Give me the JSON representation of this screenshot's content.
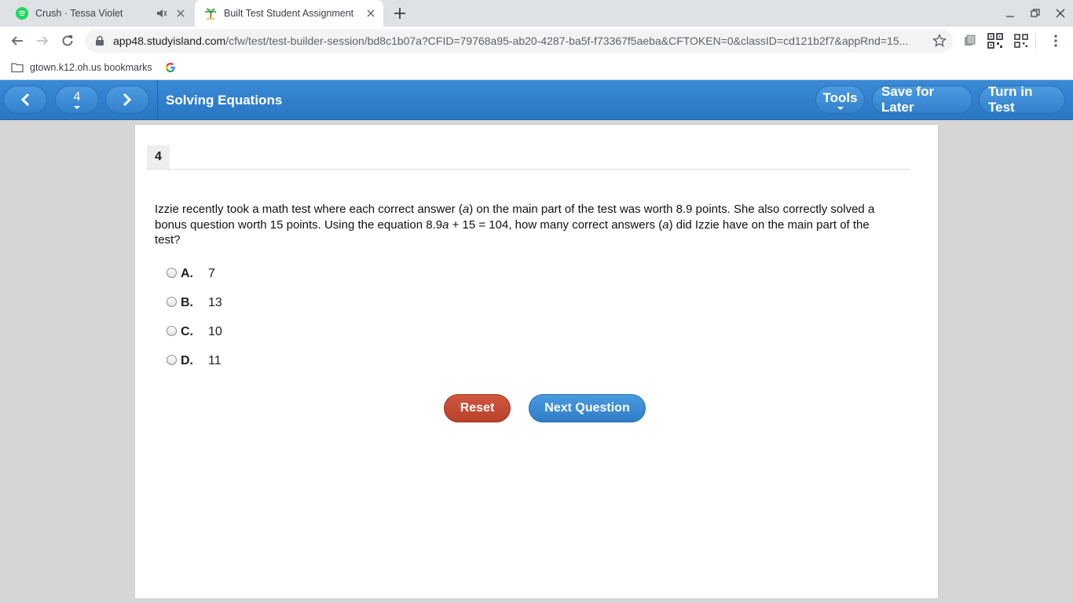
{
  "browser": {
    "tabs": [
      {
        "title": "Crush · Tessa Violet",
        "icon": "spotify-icon",
        "active": false
      },
      {
        "title": "Built Test Student Assignment",
        "icon": "studyisland-palm-icon",
        "active": true
      }
    ],
    "url_host": "app48.studyisland.com",
    "url_path": "/cfw/test/test-builder-session/bd8c1b07a?CFID=79768a95-ab20-4287-ba5f-f73367f5aeba&CFTOKEN=0&classID=cd121b2f7&appRnd=15...",
    "bookmarks": [
      {
        "label": "gtown.k12.oh.us bookmarks",
        "icon": "folder-icon"
      },
      {
        "label": "",
        "icon": "google-icon"
      }
    ]
  },
  "header": {
    "question_number": "4",
    "title": "Solving Equations",
    "tools_label": "Tools",
    "save_label": "Save for Later",
    "turn_in_label": "Turn in Test"
  },
  "question": {
    "number": "4",
    "text_parts": {
      "p1": "Izzie recently took a math test where each correct answer (",
      "v1": "a",
      "p2": ") on the main part of the test was worth 8.9 points. She also correctly solved a bonus question worth 15 points. Using the equation 8.9",
      "v2": "a",
      "p3": " + 15 = 104, how many correct answers (",
      "v3": "a",
      "p4": ") did Izzie have on the main part of the test?"
    },
    "choices": [
      {
        "letter": "A.",
        "value": "7"
      },
      {
        "letter": "B.",
        "value": "13"
      },
      {
        "letter": "C.",
        "value": "10"
      },
      {
        "letter": "D.",
        "value": "11"
      }
    ]
  },
  "actions": {
    "reset_label": "Reset",
    "next_label": "Next Question"
  },
  "colors": {
    "header_blue": "#2f7dc8",
    "reset_red": "#c14a33",
    "next_blue": "#3a8ad6"
  }
}
